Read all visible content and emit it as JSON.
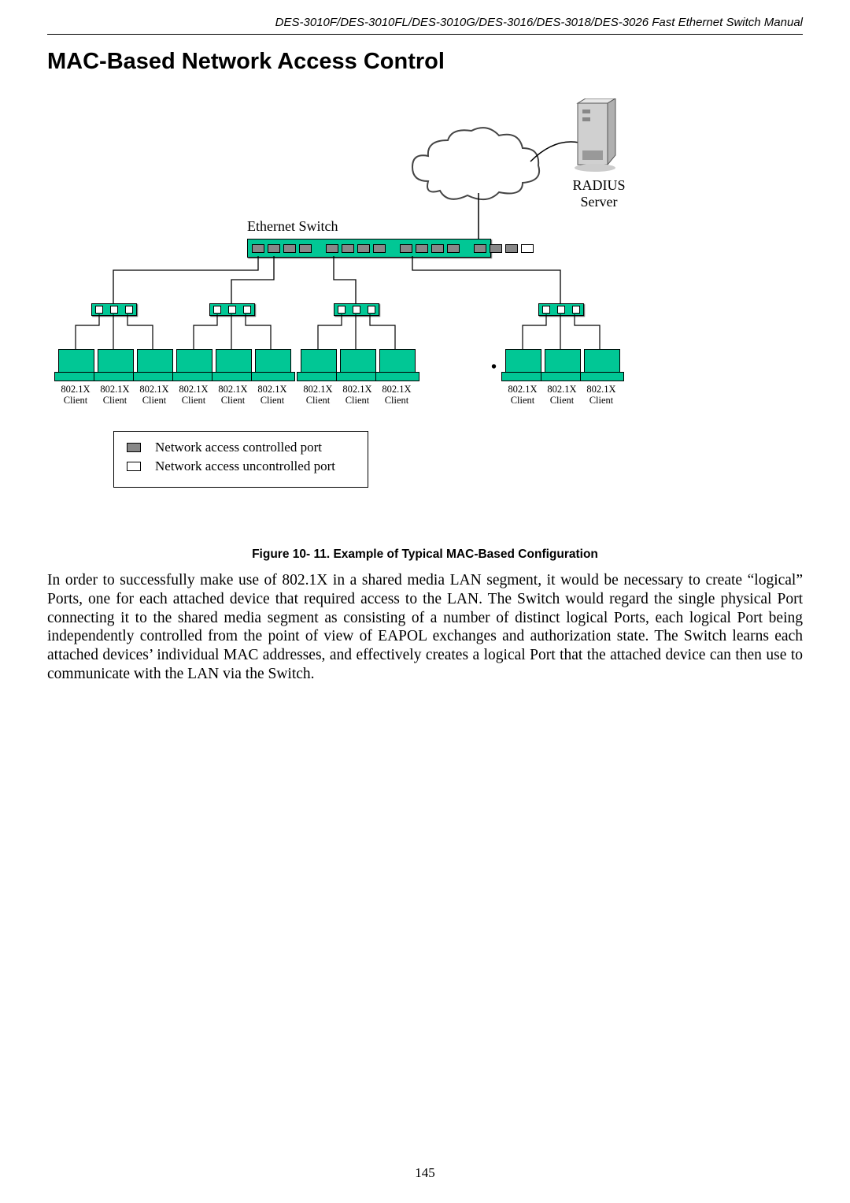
{
  "header": "DES-3010F/DES-3010FL/DES-3010G/DES-3016/DES-3018/DES-3026 Fast Ethernet Switch Manual",
  "section_title": "MAC-Based Network Access Control",
  "diagram": {
    "radius_label": "RADIUS\nServer",
    "switch_label": "Ethernet Switch",
    "client_label_top": "802.1X",
    "client_label_bottom": "Client",
    "legend_controlled": "Network access controlled port",
    "legend_uncontrolled": "Network access uncontrolled port"
  },
  "figure_caption": "Figure 10- 11. Example of Typical MAC-Based Configuration",
  "body_paragraph": "In order to successfully make use of 802.1X in a shared media LAN segment, it would be necessary to create “logical” Ports, one for each attached device that required access to the LAN. The Switch would regard the single physical Port connecting it to the shared media segment as consisting of a number of distinct logical Ports, each logical Port being independently controlled from the point of view of EAPOL exchanges and authorization state. The Switch learns each attached devices’ individual MAC addresses, and effectively creates a logical Port that the attached device can then use to communicate with the LAN via the Switch.",
  "page_number": "145"
}
